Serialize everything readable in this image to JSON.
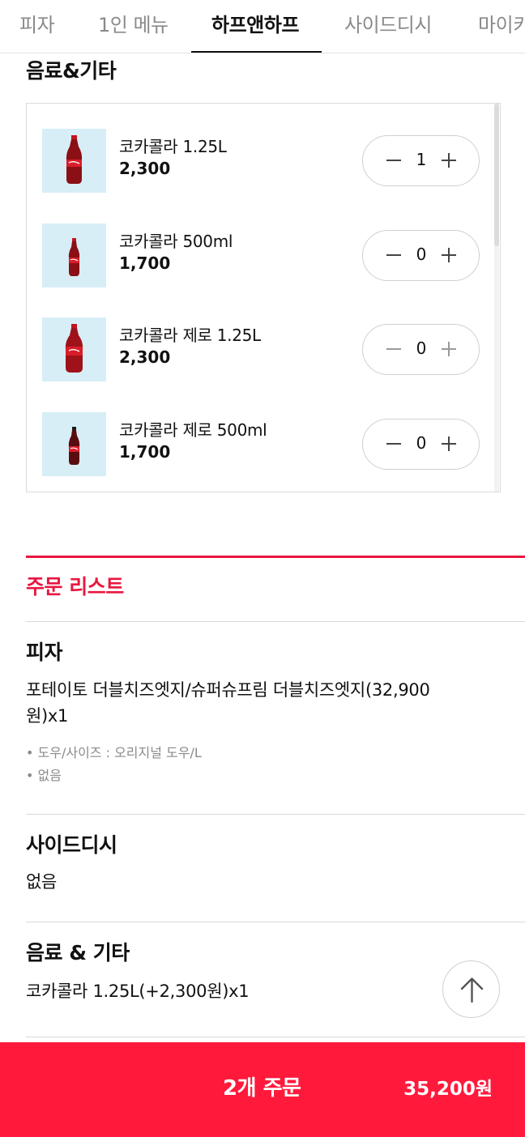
{
  "tabs": [
    {
      "label": "피자",
      "active": false
    },
    {
      "label": "1인 메뉴",
      "active": false
    },
    {
      "label": "하프앤하프",
      "active": true
    },
    {
      "label": "사이드디시",
      "active": false
    },
    {
      "label": "마이키",
      "active": false
    }
  ],
  "drinks_section": {
    "title": "음료&기타",
    "items": [
      {
        "name": "코카콜라 1.25L",
        "price": "2,300",
        "quantity": "1",
        "image_icon": "coke-bottle-large"
      },
      {
        "name": "코카콜라 500ml",
        "price": "1,700",
        "quantity": "0",
        "image_icon": "coke-bottle-small"
      },
      {
        "name": "코카콜라 제로 1.25L",
        "price": "2,300",
        "quantity": "0",
        "image_icon": "coke-bottle-large"
      },
      {
        "name": "코카콜라 제로 500ml",
        "price": "1,700",
        "quantity": "0",
        "image_icon": "coke-bottle-small"
      }
    ]
  },
  "order_list": {
    "title": "주문 리스트",
    "pizza": {
      "title": "피자",
      "line1": "포테이토 더블치즈엣지/슈퍼슈프림 더블치즈엣지(32,900",
      "line2": "원)x1",
      "options": [
        "• 도우/사이즈 : 오리지널 도우/L",
        "• 없음"
      ]
    },
    "side": {
      "title": "사이드디시",
      "value": "없음"
    },
    "drinks": {
      "title": "음료 & 기타",
      "value": "코카콜라 1.25L(+2,300원)x1"
    }
  },
  "order_button": {
    "label": "2개 주문",
    "total": "35,200원"
  },
  "colors": {
    "accent": "#e8173f",
    "order_bar": "#ff1a3c",
    "thumb_bg": "#d7eef7"
  },
  "icons": {
    "scroll_top": "arrow-up-icon",
    "minus": "minus-icon",
    "plus": "plus-icon"
  }
}
